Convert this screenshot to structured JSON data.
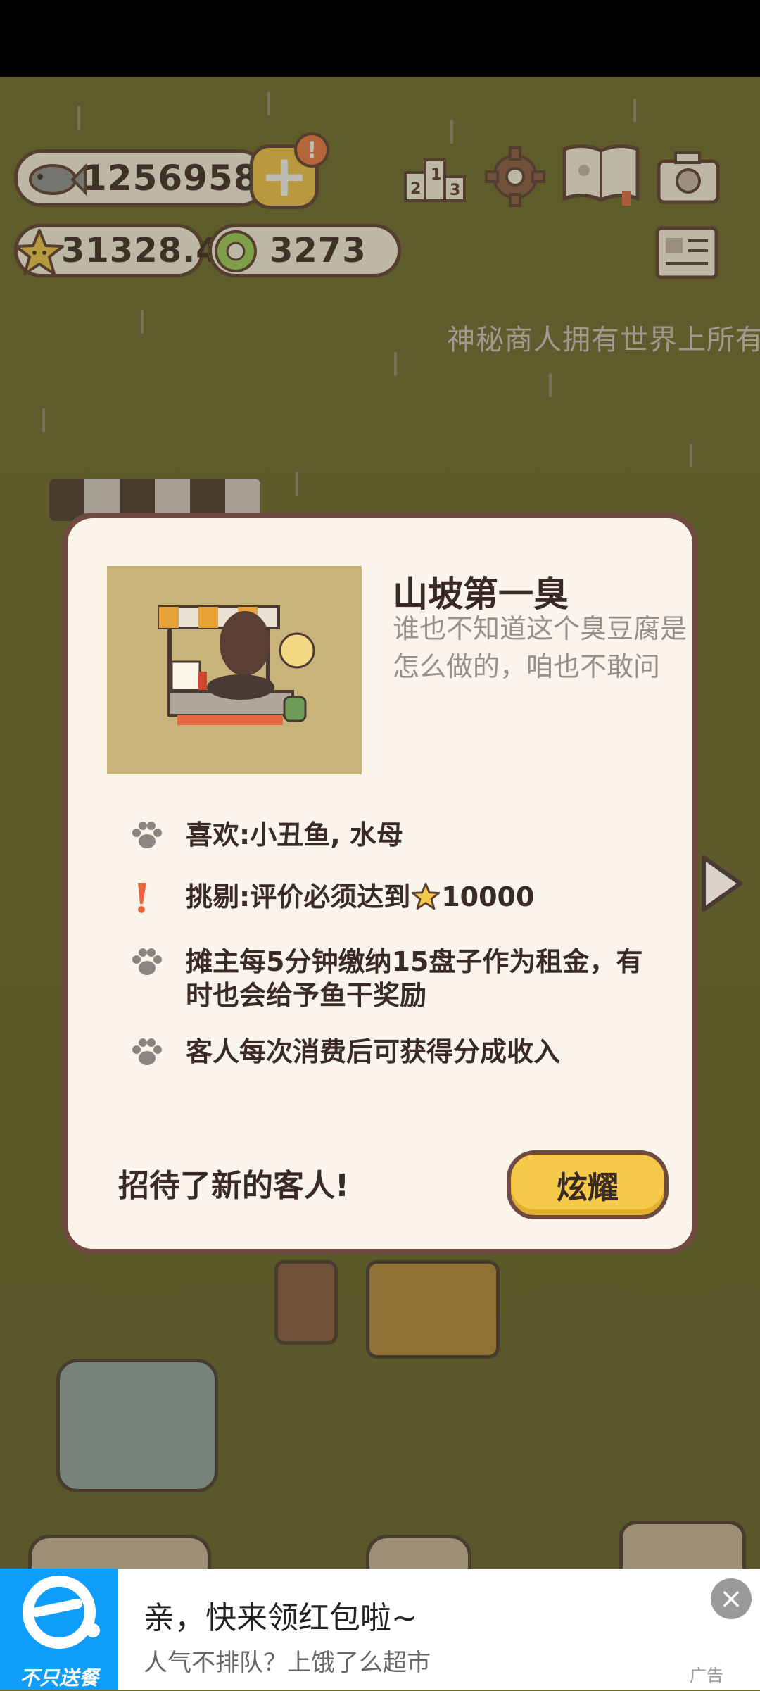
{
  "hud": {
    "fish_count": "1256958",
    "star_rating": "31328.4",
    "coin_count": "3273",
    "alert_mark": "!"
  },
  "ticker_text": "神秘商人拥有世界上所有",
  "dialog": {
    "title": "山坡第一臭",
    "description": "谁也不知道这个臭豆腐是怎么做的，咱也不敢问",
    "rows": [
      {
        "text": "喜欢:小丑鱼, 水母",
        "icon": "paw-icon"
      },
      {
        "text_before": "挑剔:评价必须达到",
        "text_after": "10000",
        "icon": "exclamation-icon"
      },
      {
        "text": "摊主每5分钟缴纳15盘子作为租金，有时也会给予鱼干奖励",
        "icon": "paw-icon"
      },
      {
        "text": "客人每次消费后可获得分成收入",
        "icon": "paw-icon"
      }
    ],
    "footer_text": "招待了新的客人!",
    "show_button": "炫耀"
  },
  "ad": {
    "title": "亲，快来领红包啦~",
    "subtitle": "人气不排队？上饿了么超市",
    "logo_text": "不只送餐",
    "tag": "广告",
    "close": "×"
  },
  "colors": {
    "accent_yellow": "#f5c94a",
    "border_brown": "#6e4a40",
    "dialog_bg": "#fbf4ea",
    "ad_blue": "#0f9dfc"
  }
}
